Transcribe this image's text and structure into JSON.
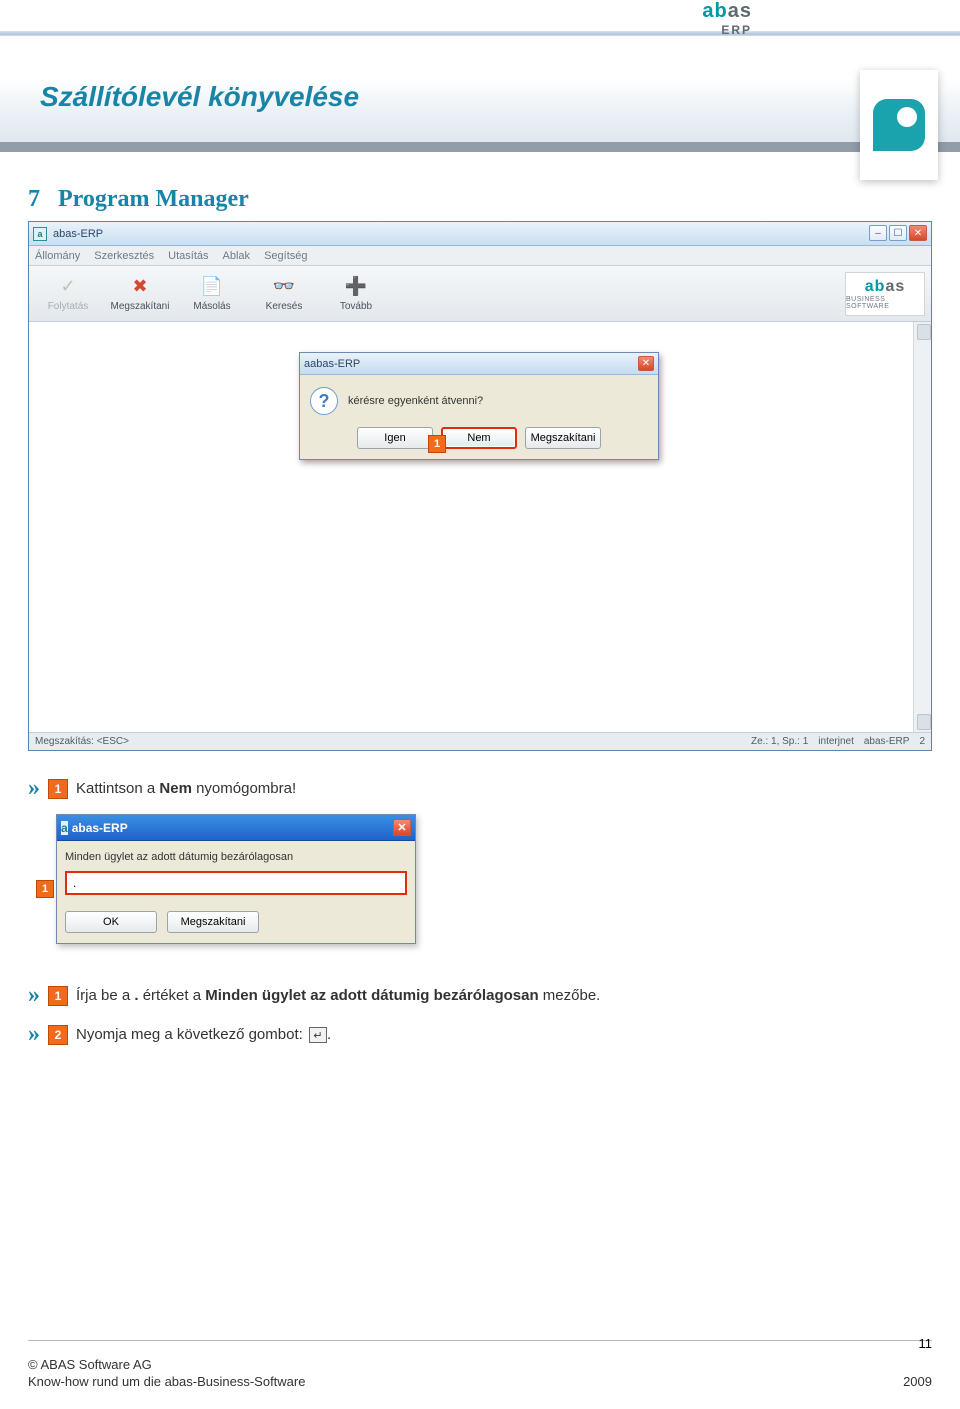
{
  "header": {
    "brand_word_a": "ab",
    "brand_word_b": "as",
    "brand_sub": "ERP",
    "page_title": "Szállítólevél könyvelése"
  },
  "section": {
    "number": "7",
    "title": "Program Manager"
  },
  "main_window": {
    "title": "abas-ERP",
    "menu": [
      "Állomány",
      "Szerkesztés",
      "Utasítás",
      "Ablak",
      "Segítség"
    ],
    "toolbar": [
      {
        "label": "Folytatás",
        "icon": "✓",
        "color": "#7aa36a",
        "disabled": true
      },
      {
        "label": "Megszakítani",
        "icon": "✖",
        "color": "#d24a2f"
      },
      {
        "label": "Másolás",
        "icon": "📄",
        "color": "#7a8fa6"
      },
      {
        "label": "Keresés",
        "icon": "👓",
        "color": "#7a8fa6"
      },
      {
        "label": "Tovább",
        "icon": "➕",
        "color": "#5fa25f"
      }
    ],
    "brand_sub": "BUSINESS SOFTWARE",
    "status_left": "Megszakítás: <ESC>",
    "status_right": [
      "Ze.: 1, Sp.: 1",
      "interjnet",
      "abas-ERP",
      "2"
    ]
  },
  "confirm_dialog": {
    "title": "abas-ERP",
    "text": "kérésre egyenként átvenni?",
    "buttons": {
      "yes": "Igen",
      "no": "Nem",
      "cancel": "Megszakítani"
    },
    "badge": "1"
  },
  "instructions": {
    "line1_pre": "Kattintson a ",
    "line1_bold": "Nem",
    "line1_post": " nyomógombra!",
    "line2_pre": "Írja be a ",
    "line2_bold_val": ".",
    "line2_mid": " értéket a ",
    "line2_bold2": "Minden ügylet az adott dátumig bezárólagosan",
    "line2_post": " mezőbe.",
    "line3_pre": "Nyomja meg a következő gombot: ",
    "line3_post": "."
  },
  "input_dialog": {
    "title": "abas-ERP",
    "label": "Minden ügylet az adott dátumig bezárólagosan",
    "value": ".",
    "ok": "OK",
    "cancel": "Megszakítani",
    "badge": "1"
  },
  "badges": {
    "one": "1",
    "two": "2"
  },
  "footer": {
    "copyright": "© ABAS Software AG",
    "tagline": "Know-how rund um die abas-Business-Software",
    "year": "2009",
    "page": "11"
  }
}
